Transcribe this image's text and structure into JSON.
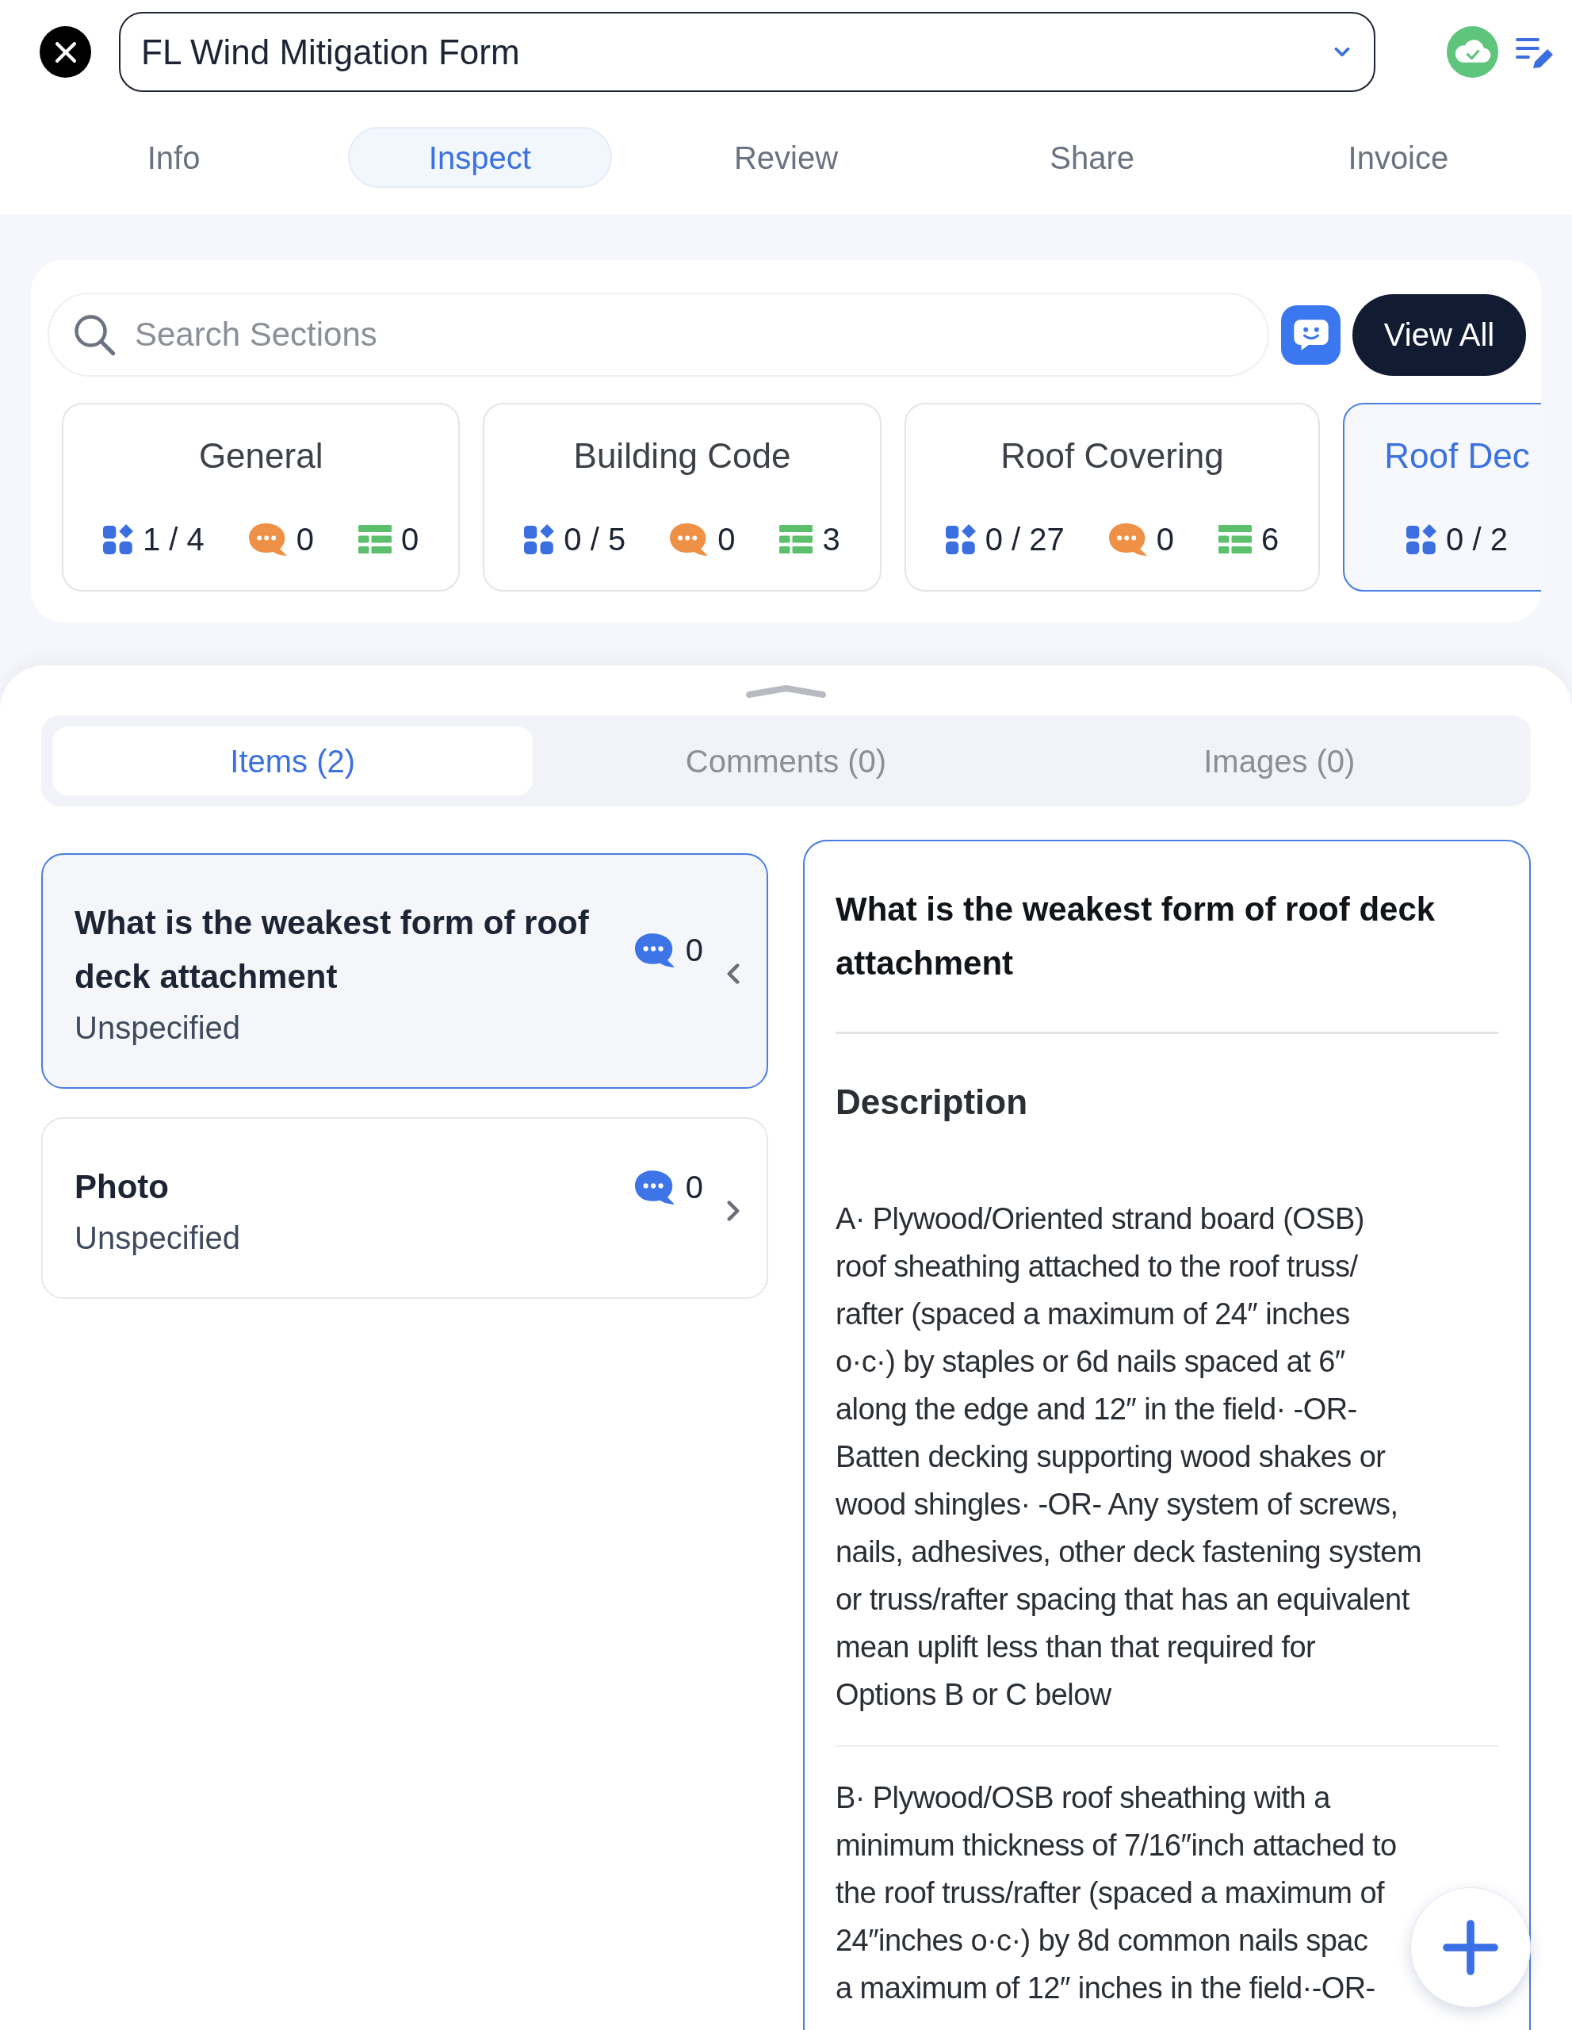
{
  "header": {
    "form_title": "FL Wind Mitigation Form"
  },
  "tabs": [
    {
      "label": "Info",
      "selected": false
    },
    {
      "label": "Inspect",
      "selected": true
    },
    {
      "label": "Review",
      "selected": false
    },
    {
      "label": "Share",
      "selected": false
    },
    {
      "label": "Invoice",
      "selected": false
    }
  ],
  "search": {
    "placeholder": "Search Sections"
  },
  "view_all_button": "View All",
  "sections": [
    {
      "title": "General",
      "selected": false,
      "progress": "1 / 4",
      "comments": "0",
      "tables": "0"
    },
    {
      "title": "Building Code",
      "selected": false,
      "progress": "0 / 5",
      "comments": "0",
      "tables": "3"
    },
    {
      "title": "Roof Covering",
      "selected": false,
      "progress": "0 / 27",
      "comments": "0",
      "tables": "6"
    },
    {
      "title": "Roof Dec",
      "selected": true,
      "progress": "0 / 2"
    }
  ],
  "detail_tabs": [
    {
      "label": "Items (2)",
      "selected": true
    },
    {
      "label": "Comments (0)",
      "selected": false
    },
    {
      "label": "Images (0)",
      "selected": false
    }
  ],
  "items": [
    {
      "title": "What is the weakest form of roof deck attachment",
      "status": "Unspecified",
      "comments": "0",
      "selected": true
    },
    {
      "title": "Photo",
      "status": "Unspecified",
      "comments": "0",
      "selected": false
    }
  ],
  "detail": {
    "title": "What is the weakest form of roof deck attachment",
    "heading": "Description",
    "paragraphs": [
      {
        "lines": [
          "A· Plywood/Oriented strand board (OSB)",
          "roof sheathing attached to the roof truss/",
          "rafter (spaced a maximum of 24″ inches",
          "o·c·) by staples or 6d nails spaced at 6″",
          "along the edge and 12″ in the field· -OR-",
          "Batten decking supporting wood shakes or",
          "wood shingles· -OR- Any system of screws,",
          "nails, adhesives, other deck fastening system",
          "or truss/rafter spacing that has an equivalent",
          "mean uplift less than that required for",
          "Options B or C below"
        ]
      },
      {
        "lines": [
          "B· Plywood/OSB roof sheathing with a",
          "minimum thickness of 7/16″inch attached to",
          "the roof truss/rafter (spaced a maximum of",
          "24″inches o·c·) by 8d common nails spac",
          "a maximum of 12″ inches in the field·-OR-"
        ]
      }
    ]
  }
}
